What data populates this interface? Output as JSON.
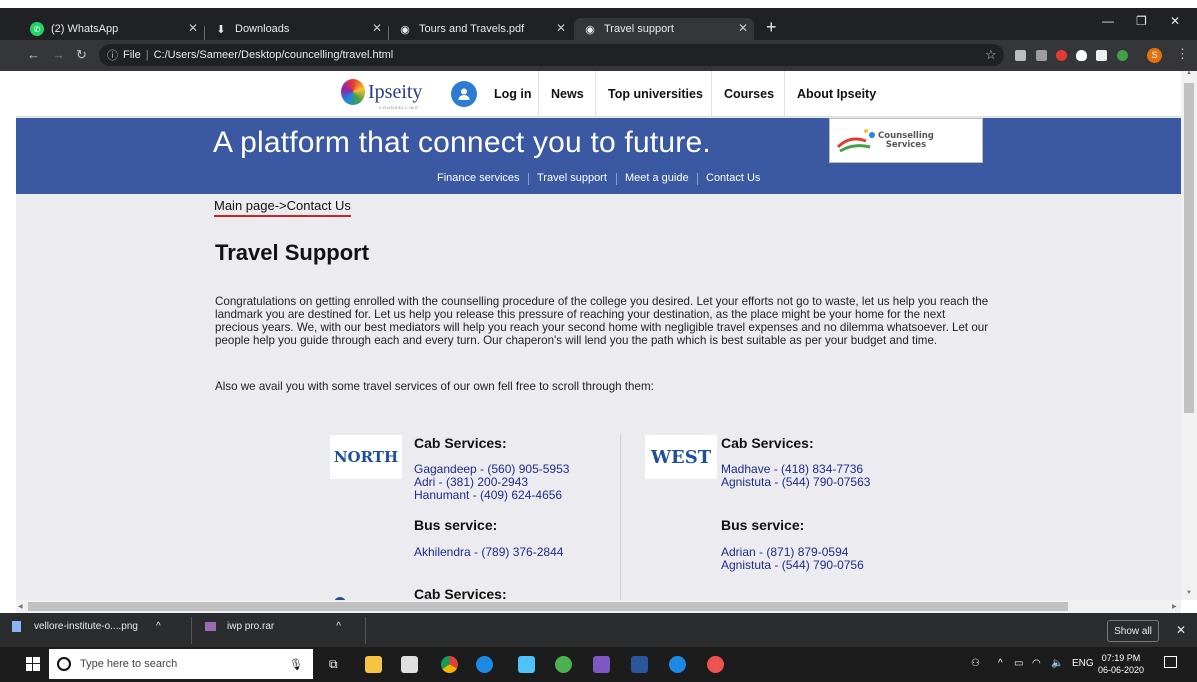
{
  "browser": {
    "tabs": [
      {
        "title": "(2) WhatsApp",
        "icon": "whatsapp-icon"
      },
      {
        "title": "Downloads",
        "icon": "download-icon"
      },
      {
        "title": "Tours and Travels.pdf",
        "icon": "globe-icon"
      },
      {
        "title": "Travel support",
        "icon": "globe-icon"
      }
    ],
    "active_tab": 3,
    "address": {
      "scheme": "File",
      "path": "C:/Users/Sameer/Desktop/councelling/travel.html"
    },
    "profile_initial": "S"
  },
  "site": {
    "logo": {
      "name": "Ipseity",
      "sub": "COUNSELLING"
    },
    "nav": [
      "Log in",
      "News",
      "Top universities",
      "Courses",
      "About Ipseity"
    ],
    "tagline": "A platform that connect you to future.",
    "partner_logo": {
      "line1": "Counselling",
      "line2": "Services"
    },
    "subnav": [
      "Finance services",
      "Travel support",
      "Meet a guide",
      "Contact Us"
    ],
    "breadcrumb": "Main page->Contact Us",
    "title": "Travel Support",
    "intro": "Congratulations on getting enrolled with the counselling procedure of the college you desired. Let your efforts not go to waste, let us help you reach the landmark you are destined for. Let us help you release this pressure of reaching your destination, as the place might be your home for the next precious years. We, with our best mediators will help you reach your second home with negligible travel expenses and no dilemma whatsoever. Let our people help you guide through each and every turn. Our chaperon's will lend you the path which is best suitable as per your budget and time.",
    "intro2": "Also we avail you with some travel services of our own fell free to scroll through them:",
    "regions": {
      "north": {
        "badge": "NORTH",
        "cab_heading": "Cab Services:",
        "cabs": [
          "Gagandeep - (560) 905-5953",
          "Adri - (381) 200-2943",
          "Hanumant - (409) 624-4656"
        ],
        "bus_heading": "Bus service:",
        "buses": [
          "Akhilendra - (789) 376-2844"
        ]
      },
      "west": {
        "badge": "WEST",
        "cab_heading": "Cab Services:",
        "cabs": [
          "Madhave - (418) 834-7736",
          "Agnistuta - (544) 790-07563"
        ],
        "bus_heading": "Bus service:",
        "buses": [
          "Adrian - (871) 879-0594",
          "Agnistuta - (544) 790-0756"
        ]
      },
      "third": {
        "cab_heading": "Cab Services:"
      }
    }
  },
  "downloads": {
    "items": [
      "vellore-institute-o....png",
      "iwp pro.rar"
    ],
    "show_all": "Show all"
  },
  "taskbar": {
    "search_placeholder": "Type here to search",
    "lang": "ENG",
    "time": "07:19 PM",
    "date": "06-06-2020"
  },
  "colors": {
    "banner": "#3b59a2",
    "link": "#1f2b8a",
    "breadcrumb_underline": "#c62828"
  }
}
